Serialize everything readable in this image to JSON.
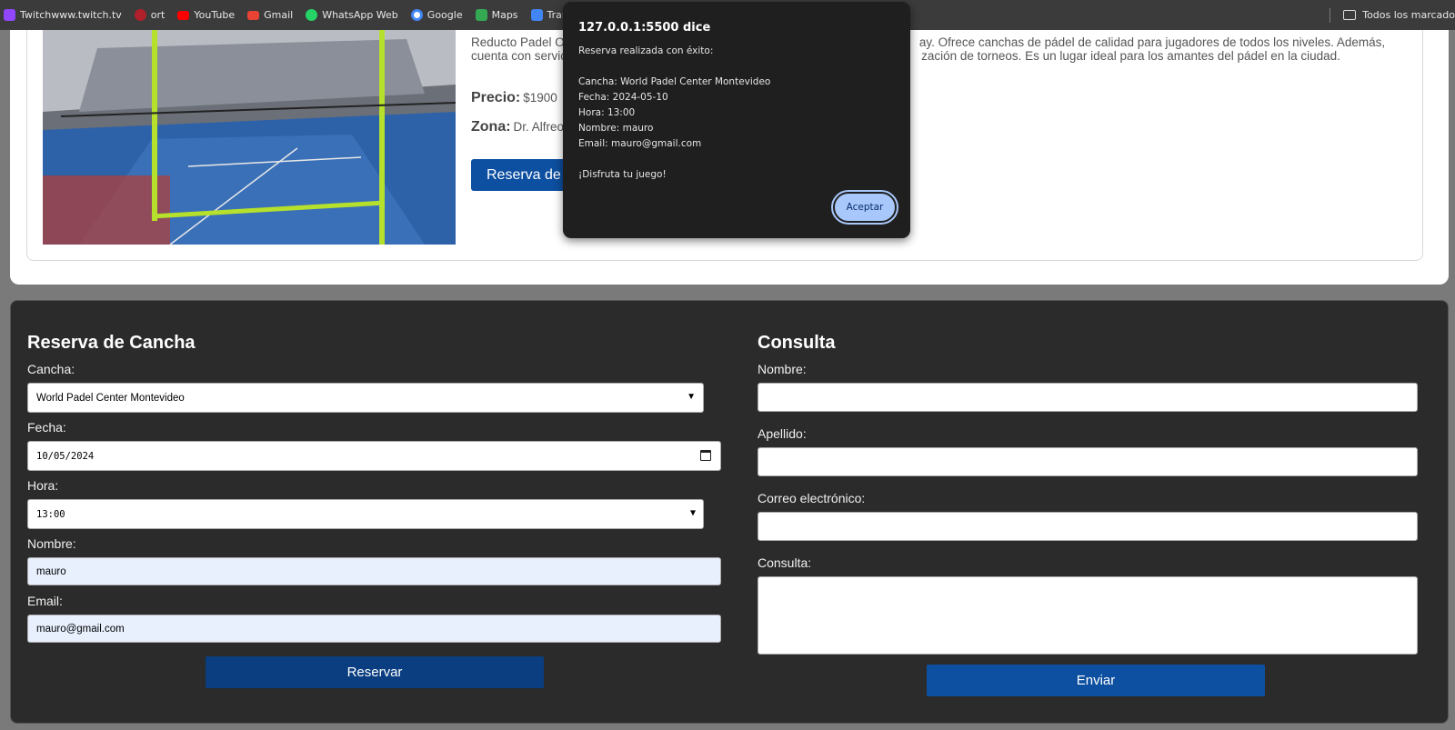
{
  "bookmarks": [
    {
      "label": "Twitchwww.twitch.tv",
      "icon": "twitch-icon",
      "color": "#9146ff"
    },
    {
      "label": "ort",
      "icon": "globe-icon",
      "color": "#b0202a"
    },
    {
      "label": "YouTube",
      "icon": "youtube-icon",
      "color": "#ff0000"
    },
    {
      "label": "Gmail",
      "icon": "gmail-icon",
      "color": "#ea4335"
    },
    {
      "label": "WhatsApp Web",
      "icon": "whatsapp-icon",
      "color": "#25d366"
    },
    {
      "label": "Google",
      "icon": "google-icon",
      "color": "#4285f4"
    },
    {
      "label": "Maps",
      "icon": "maps-icon",
      "color": "#34a853"
    },
    {
      "label": "Translate",
      "icon": "translate-icon",
      "color": "#4285f4"
    }
  ],
  "bookmarks_all": "Todos los marcado",
  "venue": {
    "description": "Reducto Padel O                                                                                                     ay. Ofrece canchas de pádel de calidad para jugadores de todos los niveles. Además, cuenta con servic                                                                                            zación de torneos. Es un lugar ideal para los amantes del pádel en la ciudad.",
    "desc_line1_left": "Reducto Padel O",
    "desc_line1_right": "ay. Ofrece canchas de pádel de calidad para jugadores de todos los niveles. Además,",
    "desc_line2_left": "cuenta con servic",
    "desc_line2_right": "zación de torneos. Es un lugar ideal para los amantes del pádel en la ciudad.",
    "price_label": "Precio:",
    "price_value": "$1900",
    "zone_label": "Zona:",
    "zone_value": "Dr. Alfreo",
    "reserve_button": "Reserva de C"
  },
  "reservation": {
    "title": "Reserva de Cancha",
    "court_label": "Cancha:",
    "court_value": "World Padel Center Montevideo",
    "date_label": "Fecha:",
    "date_value": "10/05/2024",
    "time_label": "Hora:",
    "time_value": "13:00",
    "name_label": "Nombre:",
    "name_value": "mauro",
    "email_label": "Email:",
    "email_value": "mauro@gmail.com",
    "submit": "Reservar"
  },
  "contact": {
    "title": "Consulta",
    "name_label": "Nombre:",
    "lastname_label": "Apellido:",
    "email_label": "Correo electrónico:",
    "query_label": "Consulta:",
    "submit": "Enviar"
  },
  "dialog": {
    "title": "127.0.0.1:5500 dice",
    "body": "Reserva realizada con éxito:\n\nCancha: World Padel Center Montevideo\nFecha: 2024-05-10\nHora: 13:00\nNombre: mauro\nEmail: mauro@gmail.com\n\n¡Disfruta tu juego!",
    "accept": "Aceptar"
  }
}
